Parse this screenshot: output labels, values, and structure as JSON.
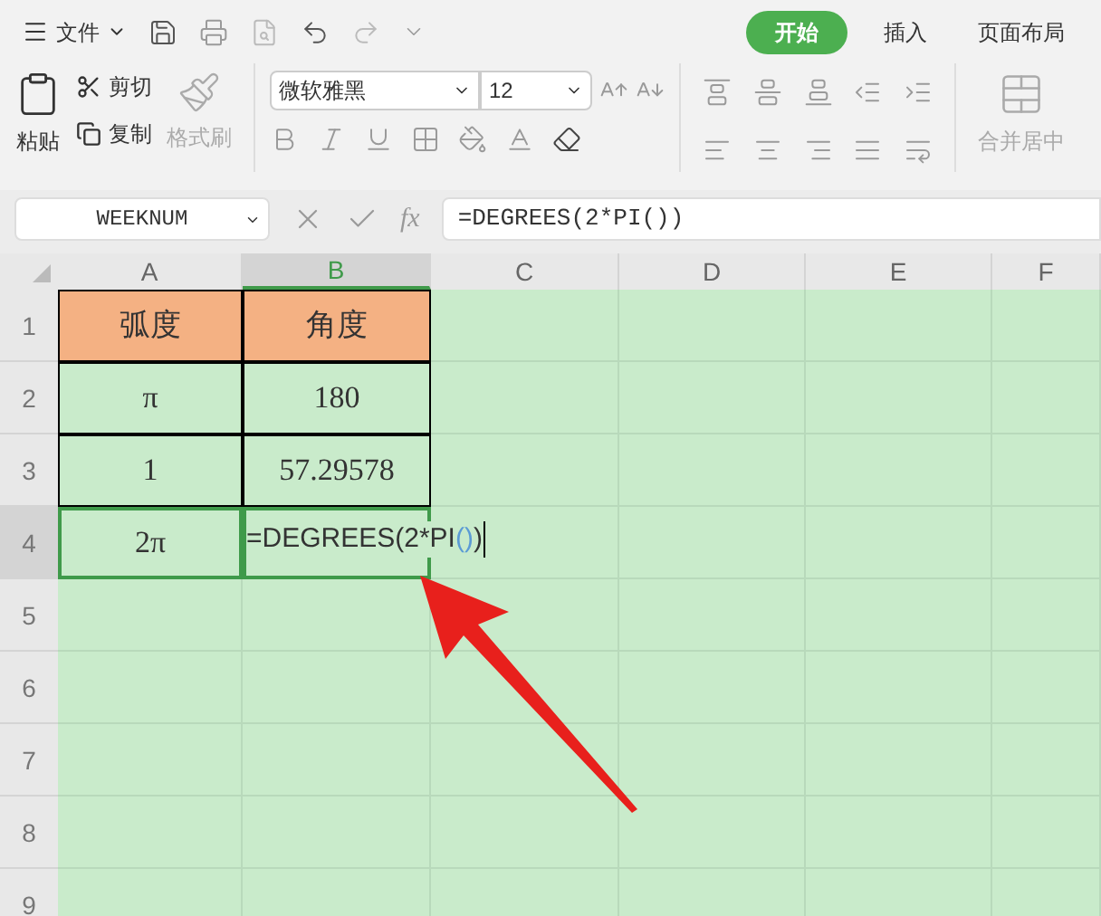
{
  "menu": {
    "label": "文件"
  },
  "tabs": [
    {
      "label": "开始",
      "selected": true
    },
    {
      "label": "插入",
      "selected": false
    },
    {
      "label": "页面布局",
      "selected": false
    }
  ],
  "ribbon": {
    "paste": "粘贴",
    "cut": "剪切",
    "copy": "复制",
    "format_painter": {
      "label": "格式刷",
      "disabled": true
    },
    "font_name": "微软雅黑",
    "font_size": "12",
    "merge": {
      "label": "合并居中",
      "disabled": true
    }
  },
  "formula_bar": {
    "name_box": "WEEKNUM",
    "fx": "fx",
    "formula": "=DEGREES(2*PI())"
  },
  "sheet": {
    "columns": [
      {
        "label": "A",
        "selected": false
      },
      {
        "label": "B",
        "selected": true
      },
      {
        "label": "C",
        "selected": false
      },
      {
        "label": "D",
        "selected": false
      },
      {
        "label": "E",
        "selected": false
      },
      {
        "label": "F",
        "selected": false
      }
    ],
    "rows": [
      {
        "label": "1",
        "selected": false,
        "cells": [
          {
            "kind": "header",
            "text": "弧度"
          },
          {
            "kind": "header",
            "text": "角度"
          }
        ]
      },
      {
        "label": "2",
        "selected": false,
        "cells": [
          {
            "kind": "value",
            "text": "π"
          },
          {
            "kind": "value",
            "text": "180"
          }
        ]
      },
      {
        "label": "3",
        "selected": false,
        "cells": [
          {
            "kind": "value",
            "text": "1"
          },
          {
            "kind": "value",
            "text": "57.29578"
          }
        ]
      },
      {
        "label": "4",
        "selected": true,
        "cells": [
          {
            "kind": "selected",
            "text": "2π"
          },
          {
            "kind": "editing",
            "parts": [
              "=DEGREES(2*PI",
              "()",
              ")"
            ]
          }
        ]
      },
      {
        "label": "5",
        "selected": false,
        "cells": []
      },
      {
        "label": "6",
        "selected": false,
        "cells": []
      },
      {
        "label": "7",
        "selected": false,
        "cells": []
      },
      {
        "label": "8",
        "selected": false,
        "cells": []
      },
      {
        "label": "9",
        "selected": false,
        "cells": []
      }
    ]
  }
}
